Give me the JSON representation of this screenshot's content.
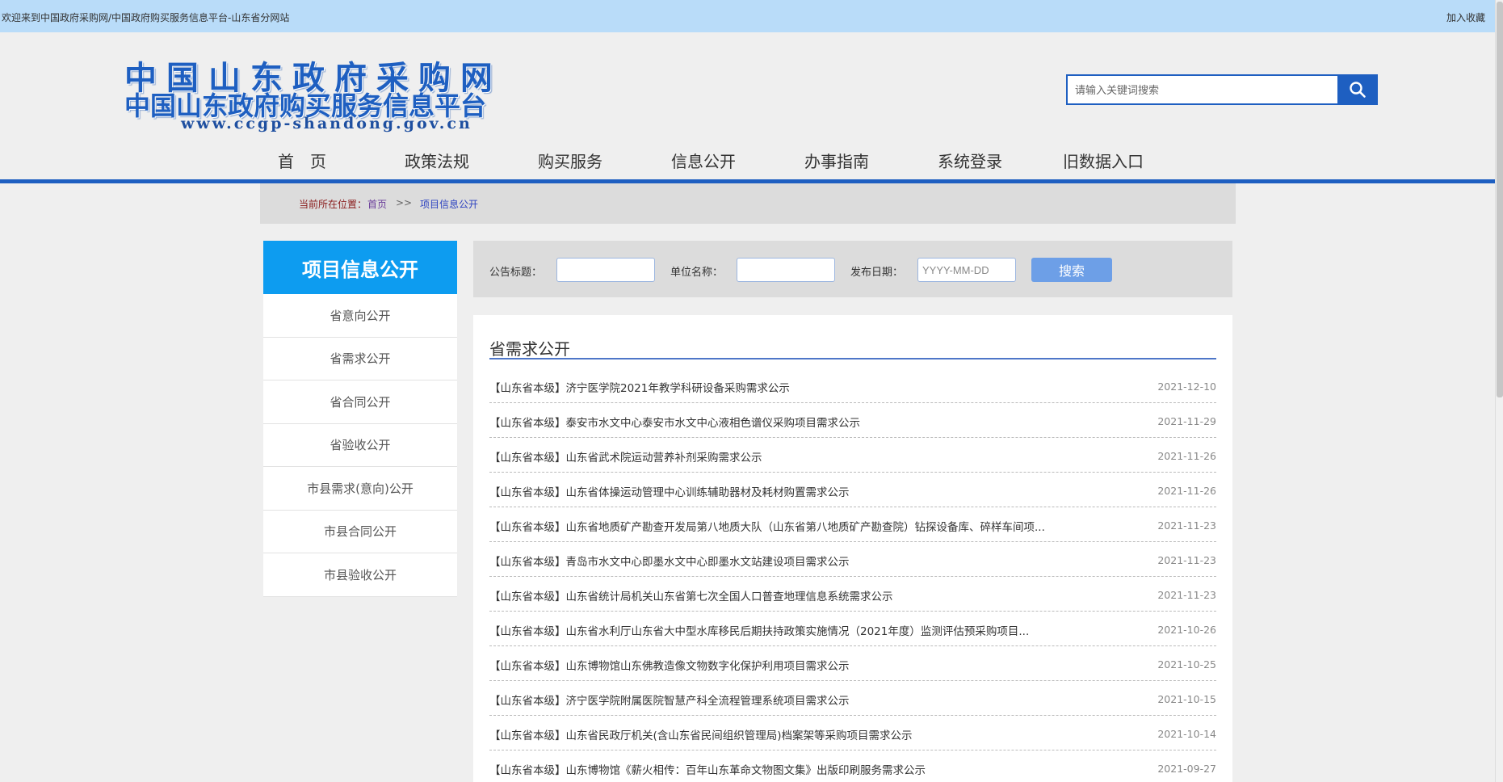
{
  "topbar": {
    "welcome": "欢迎来到中国政府采购网/中国政府购买服务信息平台-山东省分网站",
    "favorite": "加入收藏"
  },
  "logo": {
    "line1": "中国山东政府采购网",
    "line2": "中国山东政府购买服务信息平台",
    "url": "www.ccgp-shandong.gov.cn"
  },
  "search": {
    "placeholder": "请输入关键词搜索",
    "icon": "search-icon"
  },
  "nav": {
    "items": [
      "首　页",
      "政策法规",
      "购买服务",
      "信息公开",
      "办事指南",
      "系统登录",
      "旧数据入口"
    ]
  },
  "breadcrumb": {
    "label": "当前所在位置：",
    "home": "首页",
    "separator": ">>",
    "current": "项目信息公开"
  },
  "sidebar": {
    "title": "项目信息公开",
    "items": [
      "省意向公开",
      "省需求公开",
      "省合同公开",
      "省验收公开",
      "市县需求(意向)公开",
      "市县合同公开",
      "市县验收公开"
    ]
  },
  "filter": {
    "title_label": "公告标题：",
    "title_value": "",
    "unit_label": "单位名称：",
    "unit_value": "",
    "date_label": "发布日期：",
    "date_placeholder": "YYYY-MM-DD",
    "search_button": "搜索"
  },
  "content": {
    "section_title": "省需求公开",
    "rows": [
      {
        "title": "【山东省本级】济宁医学院2021年教学科研设备采购需求公示",
        "date": "2021-12-10"
      },
      {
        "title": "【山东省本级】泰安市水文中心泰安市水文中心液相色谱仪采购项目需求公示",
        "date": "2021-11-29"
      },
      {
        "title": "【山东省本级】山东省武术院运动营养补剂采购需求公示",
        "date": "2021-11-26"
      },
      {
        "title": "【山东省本级】山东省体操运动管理中心训练辅助器材及耗材购置需求公示",
        "date": "2021-11-26"
      },
      {
        "title": "【山东省本级】山东省地质矿产勘查开发局第八地质大队（山东省第八地质矿产勘查院）钻探设备库、碎样车间项...",
        "date": "2021-11-23"
      },
      {
        "title": "【山东省本级】青岛市水文中心即墨水文中心即墨水文站建设项目需求公示",
        "date": "2021-11-23"
      },
      {
        "title": "【山东省本级】山东省统计局机关山东省第七次全国人口普查地理信息系统需求公示",
        "date": "2021-11-23"
      },
      {
        "title": "【山东省本级】山东省水利厅山东省大中型水库移民后期扶持政策实施情况（2021年度）监测评估预采购项目...",
        "date": "2021-10-26"
      },
      {
        "title": "【山东省本级】山东博物馆山东佛教造像文物数字化保护利用项目需求公示",
        "date": "2021-10-25"
      },
      {
        "title": "【山东省本级】济宁医学院附属医院智慧产科全流程管理系统项目需求公示",
        "date": "2021-10-15"
      },
      {
        "title": "【山东省本级】山东省民政厅机关(含山东省民间组织管理局)档案架等采购项目需求公示",
        "date": "2021-10-14"
      },
      {
        "title": "【山东省本级】山东博物馆《薪火相传：百年山东革命文物图文集》出版印刷服务需求公示",
        "date": "2021-09-27"
      }
    ]
  },
  "colors": {
    "primary": "#1e5fc1",
    "topbar": "#b9dcf9",
    "sidebar_header": "#0d9cf0",
    "search_button": "#6d9fe7"
  }
}
